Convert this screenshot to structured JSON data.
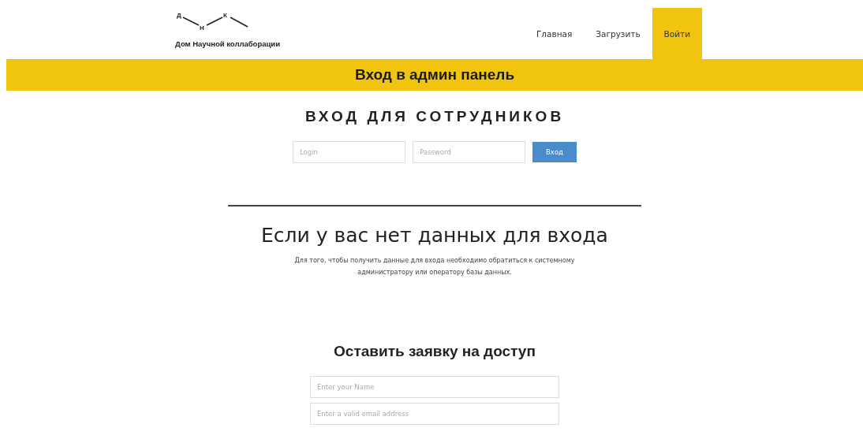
{
  "logo": {
    "letters": [
      "Д",
      "Н",
      "К"
    ],
    "caption": "Дом Научной коллаборации"
  },
  "nav": [
    {
      "label": "Главная",
      "selected": false
    },
    {
      "label": "Загрузить",
      "selected": false
    },
    {
      "label": "Войти",
      "selected": true
    }
  ],
  "banner": "Вход в админ панель",
  "login": {
    "title": "ВХОД ДЛЯ СОТРУДНИКОВ",
    "fields": [
      {
        "placeholder": "Login"
      },
      {
        "placeholder": "Password"
      }
    ],
    "button": "Вход"
  },
  "no_access": {
    "heading": "Если у вас нет данных для входа",
    "text": "Для того, чтобы получить данные для входа необходимо обратиться к системному администратору или оператору базы данных."
  },
  "request": {
    "title": "Оставить заявку на доступ",
    "fields": [
      {
        "placeholder": "Enter your Name"
      },
      {
        "placeholder": "Enter a valid email address"
      }
    ]
  }
}
